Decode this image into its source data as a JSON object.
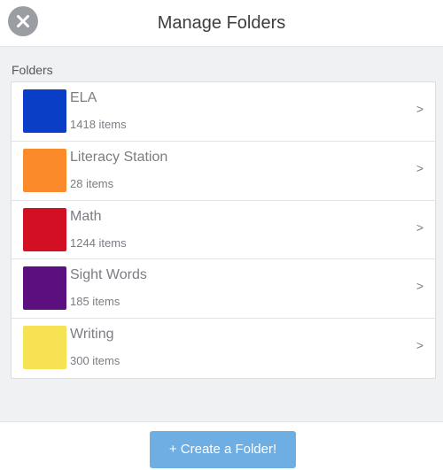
{
  "header": {
    "title": "Manage Folders",
    "close_icon": "close-icon"
  },
  "section": {
    "label": "Folders"
  },
  "folders": [
    {
      "name": "ELA",
      "count": "1418 items",
      "color": "#0a3ec7",
      "chevron": ">"
    },
    {
      "name": "Literacy Station",
      "count": "28 items",
      "color": "#fb8a2a",
      "chevron": ">"
    },
    {
      "name": "Math",
      "count": "1244 items",
      "color": "#d30f24",
      "chevron": ">"
    },
    {
      "name": "Sight Words",
      "count": "185 items",
      "color": "#5c0f7e",
      "chevron": ">"
    },
    {
      "name": "Writing",
      "count": "300 items",
      "color": "#f6e253",
      "chevron": ">"
    }
  ],
  "footer": {
    "create_label": "+ Create a Folder!"
  }
}
